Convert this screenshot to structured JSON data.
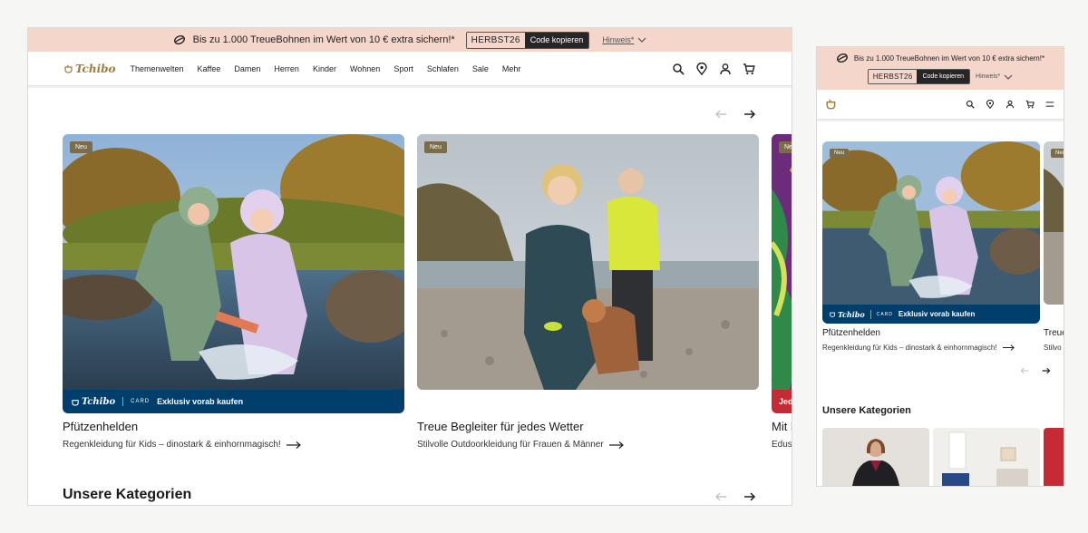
{
  "promo": {
    "text": "Bis zu 1.000 TreueBohnen im Wert von 10 € extra sichern!*",
    "code": "HERBST26",
    "copy_label": "Code kopieren",
    "hint_label": "Hinweis*"
  },
  "brand": {
    "logo_text": "Tchibo"
  },
  "nav": {
    "items": [
      "Themenwelten",
      "Kaffee",
      "Damen",
      "Herren",
      "Kinder",
      "Wohnen",
      "Sport",
      "Schlafen",
      "Sale",
      "Mehr"
    ]
  },
  "cards": [
    {
      "badge": "Neu",
      "title": "Pfützenhelden",
      "subtitle": "Regenkleidung für Kids – dinostark & einhornmagisch!",
      "strip_logo": "Tchibo",
      "strip_card": "CARD",
      "strip_text": "Exklusiv vorab kaufen"
    },
    {
      "badge": "Neu",
      "title": "Treue Begleiter für jedes Wetter",
      "subtitle": "Stilvolle Outdoorkleidung für Frauen & Männer"
    },
    {
      "badge": "Ne",
      "title": "Mit l",
      "subtitle": "Eduso",
      "strip_text": "Jed"
    }
  ],
  "mobile_cards": [
    {
      "badge": "Neu",
      "title": "Pfützenhelden",
      "subtitle": "Regenkleidung für Kids – dinostark & einhornmagisch!",
      "strip_logo": "Tchibo",
      "strip_card": "CARD",
      "strip_text": "Exklusiv vorab kaufen"
    },
    {
      "badge": "Neu",
      "title": "Treue",
      "subtitle": "Stilvo"
    }
  ],
  "categories": {
    "title": "Unsere Kategorien"
  },
  "colors": {
    "promo_bg": "#f4d6cb",
    "brand_gold": "#a07b3c",
    "card_blue": "#003e6b",
    "badge_bg": "#7b6c4b"
  }
}
